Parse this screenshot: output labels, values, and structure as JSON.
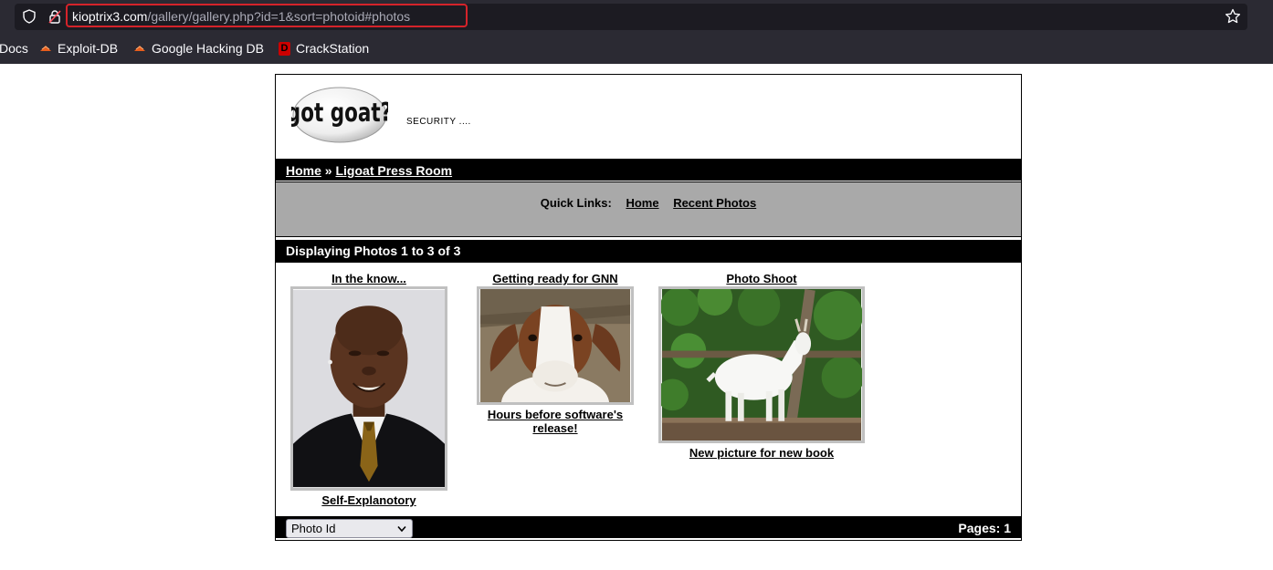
{
  "browser": {
    "url_host": "kioptrix3.com",
    "url_path": "/gallery/gallery.php?id=1&sort=photoid#photos",
    "bookmarks": [
      "Docs",
      "Exploit-DB",
      "Google Hacking DB",
      "CrackStation"
    ],
    "crackstation_icon_letter": "D",
    "highlight_color": "#d5232a"
  },
  "header": {
    "logo_text": "got goat?",
    "tagline": "SECURITY ...."
  },
  "breadcrumb": {
    "home": "Home",
    "separator": "»",
    "section": "Ligoat Press Room"
  },
  "quick_links": {
    "label": "Quick Links:",
    "home": "Home",
    "recent": "Recent Photos"
  },
  "display_text": "Displaying Photos 1 to 3 of 3",
  "photos": [
    {
      "title": "In the know...",
      "caption": "Self-Explanotory"
    },
    {
      "title": "Getting ready for GNN",
      "caption": "Hours before software's release!"
    },
    {
      "title": "Photo Shoot",
      "caption": "New picture for new book"
    }
  ],
  "footer": {
    "sort_selected": "Photo Id",
    "pages": "Pages: 1"
  }
}
